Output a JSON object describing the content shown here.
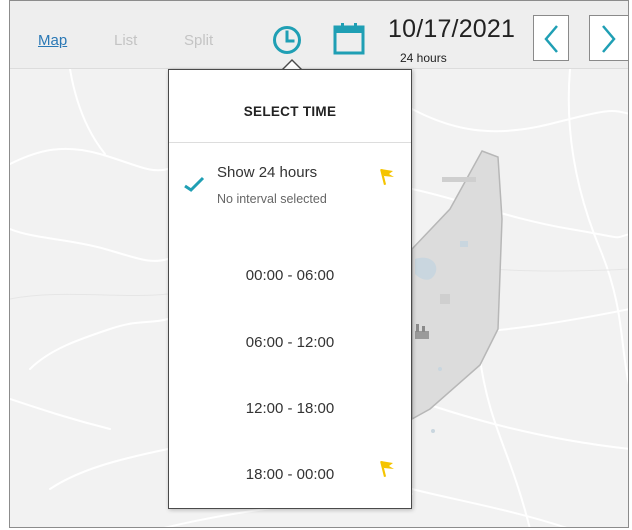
{
  "toolbar": {
    "tabs": [
      {
        "label": "Map",
        "active": true
      },
      {
        "label": "List",
        "active": false
      },
      {
        "label": "Split",
        "active": false
      }
    ],
    "date": "10/17/2021",
    "duration": "24 hours",
    "icons": [
      "clock-icon",
      "calendar-icon",
      "chevron-left-icon",
      "chevron-right-icon"
    ]
  },
  "popup": {
    "title": "SELECT TIME",
    "show_all": {
      "label": "Show 24 hours",
      "sublabel": "No interval selected",
      "selected": true
    },
    "intervals": [
      "00:00 - 06:00",
      "06:00 - 12:00",
      "12:00 - 18:00",
      "18:00 - 00:00"
    ]
  },
  "colors": {
    "accent": "#1f9fb4",
    "link": "#2a78b5",
    "flag": "#f5c400",
    "inactive_tab": "#c4c4c4"
  }
}
